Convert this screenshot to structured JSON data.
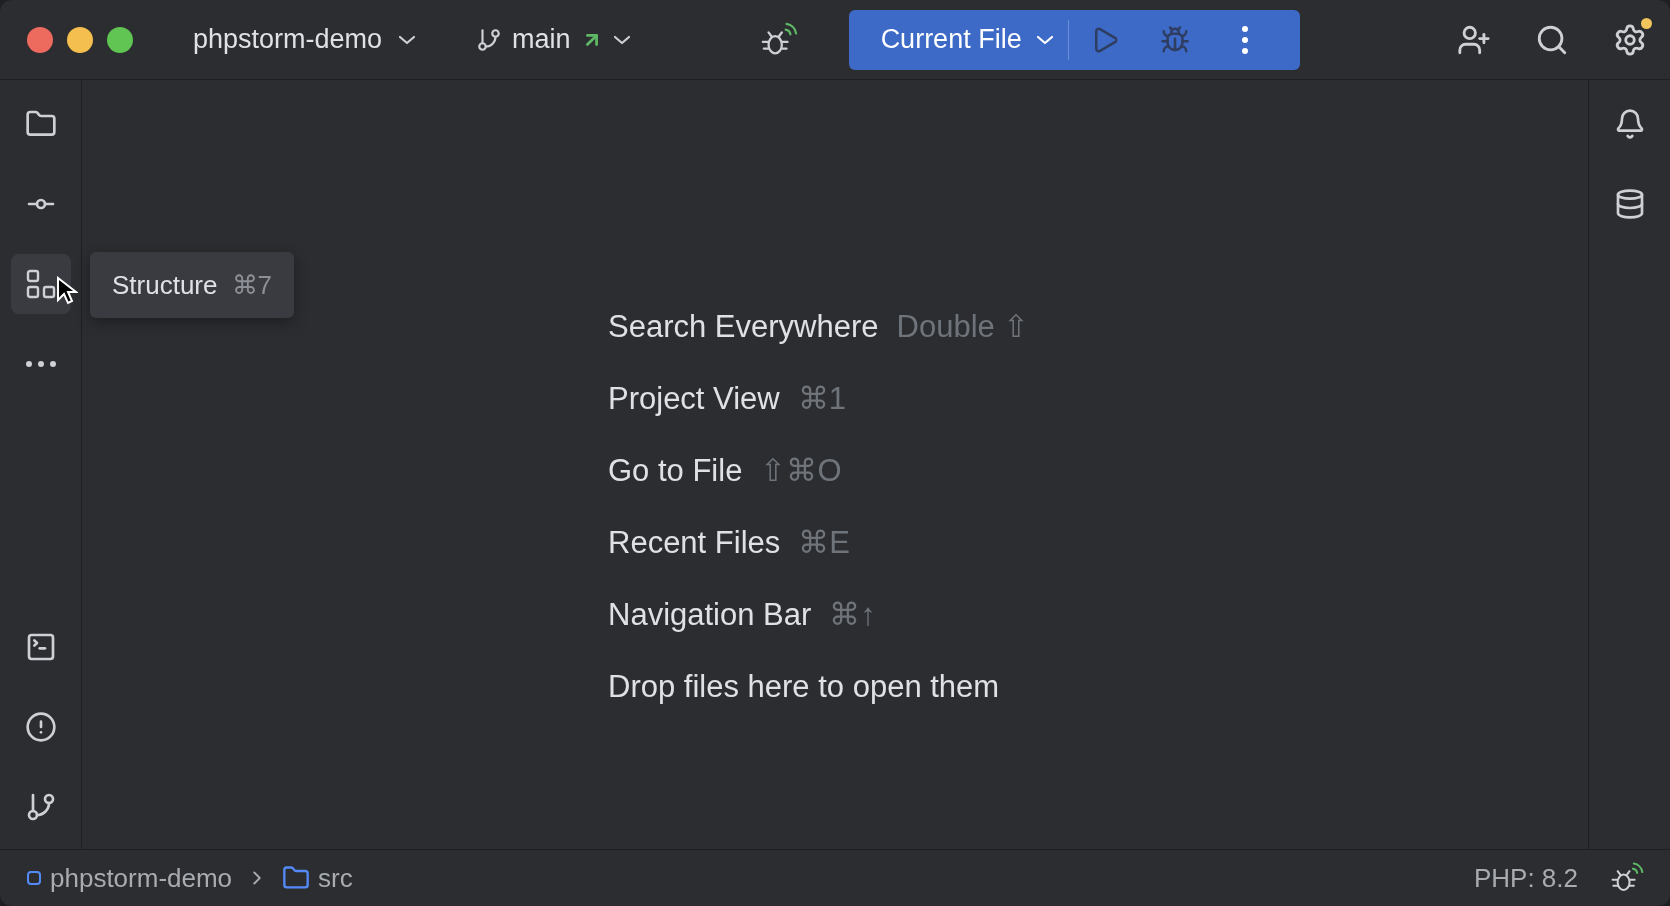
{
  "title_bar": {
    "project": "phpstorm-demo",
    "branch": "main",
    "run_config": "Current File",
    "settings_update": true
  },
  "left_tools": [
    {
      "kind": "project",
      "selected": false
    },
    {
      "kind": "commit",
      "selected": false
    },
    {
      "kind": "structure",
      "selected": true
    },
    {
      "kind": "more",
      "selected": false
    }
  ],
  "left_tools_bottom": [
    {
      "kind": "terminal",
      "selected": false
    },
    {
      "kind": "problems",
      "selected": false
    },
    {
      "kind": "git",
      "selected": false
    }
  ],
  "right_tools": [
    {
      "kind": "notifications",
      "selected": false
    },
    {
      "kind": "database",
      "selected": false
    }
  ],
  "tooltip": {
    "label": "Structure",
    "shortcut": "⌘7"
  },
  "hints": [
    {
      "label": "Search Everywhere",
      "shortcut": "Double ⇧"
    },
    {
      "label": "Project View",
      "shortcut": "⌘1"
    },
    {
      "label": "Go to File",
      "shortcut": "⇧⌘O"
    },
    {
      "label": "Recent Files",
      "shortcut": "⌘E"
    },
    {
      "label": "Navigation Bar",
      "shortcut": "⌘↑"
    },
    {
      "label": "Drop files here to open them"
    }
  ],
  "status_bar": {
    "breadcrumbs": [
      {
        "kind": "module",
        "label": "phpstorm-demo"
      },
      {
        "kind": "folder",
        "label": "src"
      }
    ],
    "php": "PHP: 8.2"
  }
}
